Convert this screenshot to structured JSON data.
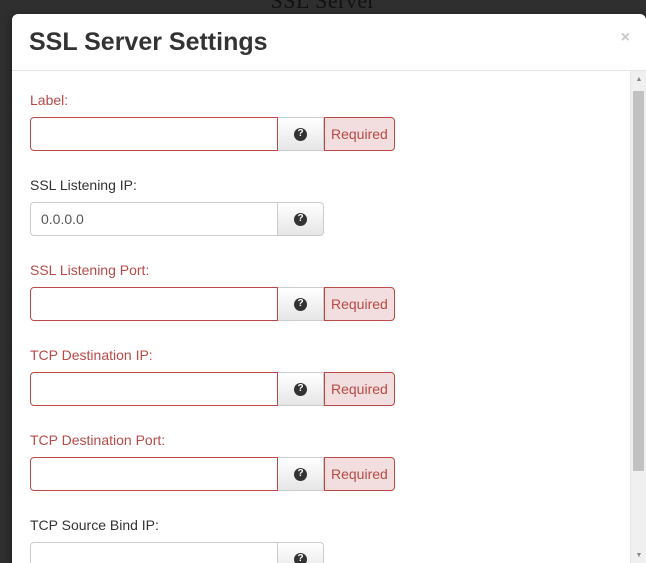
{
  "backdrop": {
    "title": "SSL Server"
  },
  "modal": {
    "title": "SSL Server Settings",
    "close_label": "×",
    "help_glyph": "?",
    "required_label": "Required"
  },
  "fields": [
    {
      "label": "Label:",
      "value": "",
      "required": true
    },
    {
      "label": "SSL Listening IP:",
      "value": "0.0.0.0",
      "required": false
    },
    {
      "label": "SSL Listening Port:",
      "value": "",
      "required": true
    },
    {
      "label": "TCP Destination IP:",
      "value": "",
      "required": true
    },
    {
      "label": "TCP Destination Port:",
      "value": "",
      "required": true
    },
    {
      "label": "TCP Source Bind IP:",
      "value": "",
      "required": false
    }
  ],
  "icons": {
    "help": "question-circle-icon",
    "close": "close-icon",
    "scroll_up": "scroll-up-arrow-icon",
    "scroll_down": "scroll-down-arrow-icon"
  },
  "colors": {
    "error": "#b94a48",
    "error_bg": "#f2dede",
    "text": "#333333"
  }
}
